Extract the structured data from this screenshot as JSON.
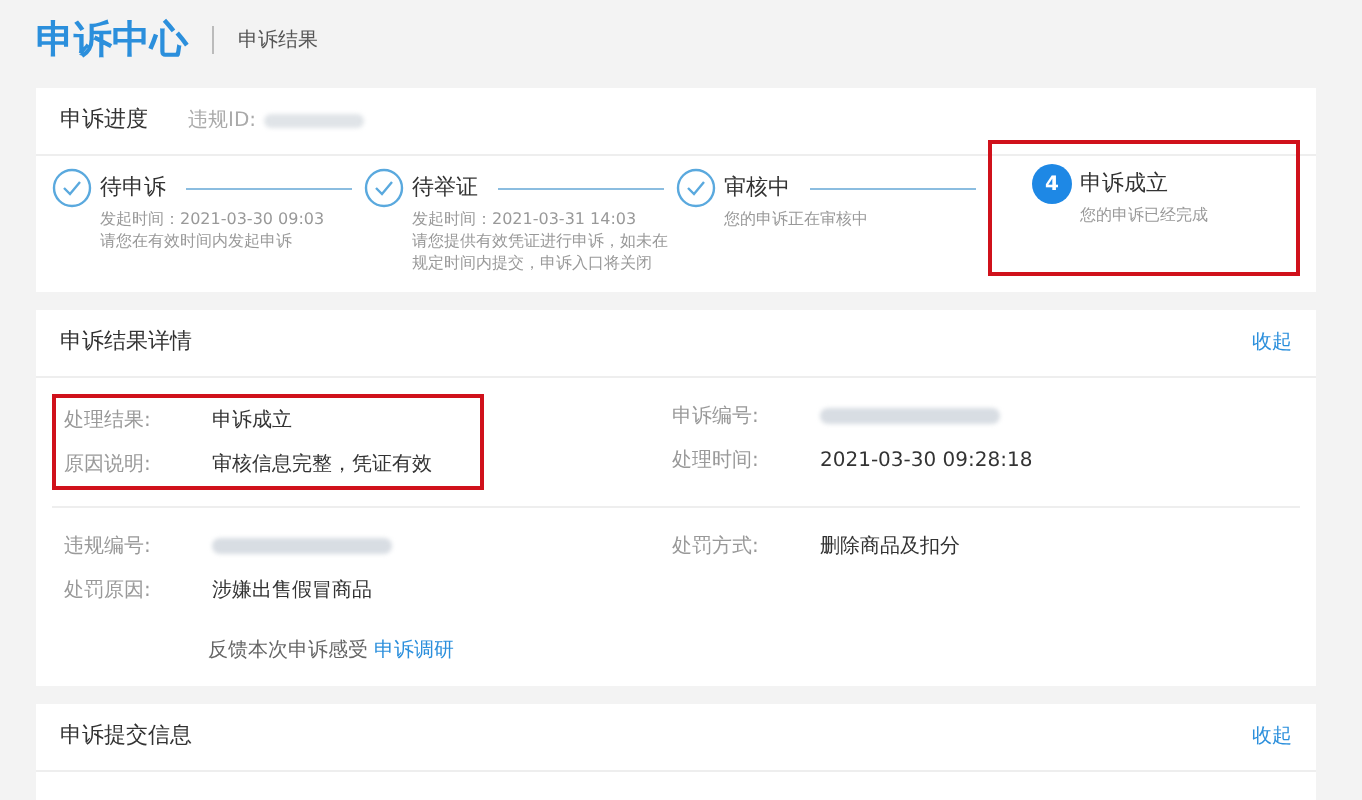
{
  "header": {
    "title": "申诉中心",
    "subtitle": "申诉结果"
  },
  "progress": {
    "title": "申诉进度",
    "id_label": "违规ID:",
    "steps": [
      {
        "kind": "done",
        "highlighted": false,
        "title": "待申诉",
        "lines": [
          "发起时间：2021-03-30 09:03",
          "请您在有效时间内发起申诉"
        ]
      },
      {
        "kind": "done",
        "highlighted": false,
        "title": "待举证",
        "lines": [
          "发起时间：2021-03-31 14:03",
          "请您提供有效凭证进行申诉，如未在规定时间内提交，申诉入口将关闭"
        ]
      },
      {
        "kind": "done",
        "highlighted": false,
        "title": "审核中",
        "lines": [
          "您的申诉正在审核中"
        ]
      },
      {
        "kind": "current",
        "highlighted": true,
        "number": "4",
        "title": "申诉成立",
        "lines": [
          "您的申诉已经完成"
        ]
      }
    ]
  },
  "result": {
    "title": "申诉结果详情",
    "collapse": "收起",
    "highlight_first_group": true,
    "groups": [
      {
        "left": [
          {
            "label": "处理结果:",
            "value": "申诉成立"
          },
          {
            "label": "原因说明:",
            "value": "审核信息完整，凭证有效"
          }
        ],
        "right": [
          {
            "label": "申诉编号:",
            "redacted": true
          },
          {
            "label": "处理时间:",
            "value": "2021-03-30 09:28:18"
          }
        ]
      },
      {
        "left": [
          {
            "label": "违规编号:",
            "redacted": true
          },
          {
            "label": "处罚原因:",
            "value": "涉嫌出售假冒商品"
          }
        ],
        "right": [
          {
            "label": "处罚方式:",
            "value": "删除商品及扣分"
          }
        ]
      }
    ],
    "feedback": {
      "text": "反馈本次申诉感受",
      "link": "申诉调研"
    }
  },
  "submit": {
    "title": "申诉提交信息",
    "collapse": "收起"
  }
}
